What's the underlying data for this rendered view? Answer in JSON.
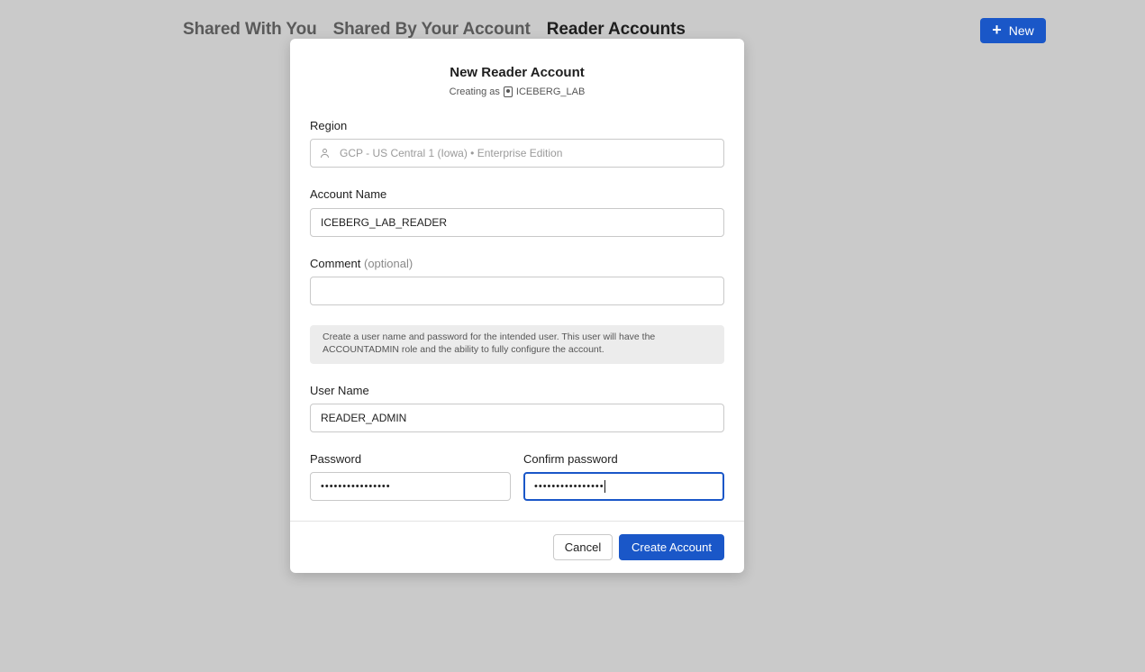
{
  "tabs": [
    {
      "label": "Shared With You"
    },
    {
      "label": "Shared By Your Account"
    },
    {
      "label": "Reader Accounts"
    }
  ],
  "new_button": {
    "label": "New",
    "icon": "plus-icon"
  },
  "modal": {
    "title": "New Reader Account",
    "creating_as_prefix": "Creating as",
    "creating_as_account": "ICEBERG_LAB",
    "region": {
      "label": "Region",
      "value": "GCP - US Central 1 (Iowa) • Enterprise Edition"
    },
    "account_name": {
      "label": "Account Name",
      "value": "ICEBERG_LAB_READER"
    },
    "comment": {
      "label": "Comment",
      "optional": "(optional)",
      "value": ""
    },
    "info_text": "Create a user name and password for the intended user. This user will have the ACCOUNTADMIN role and the ability to fully configure the account.",
    "user_name": {
      "label": "User Name",
      "value": "READER_ADMIN"
    },
    "password": {
      "label": "Password",
      "value": "••••••••••••••••"
    },
    "confirm_password": {
      "label": "Confirm password",
      "value": "••••••••••••••••"
    },
    "cancel_label": "Cancel",
    "create_label": "Create Account"
  },
  "colors": {
    "accent": "#1a57c8",
    "backdrop": "#cacaca"
  }
}
